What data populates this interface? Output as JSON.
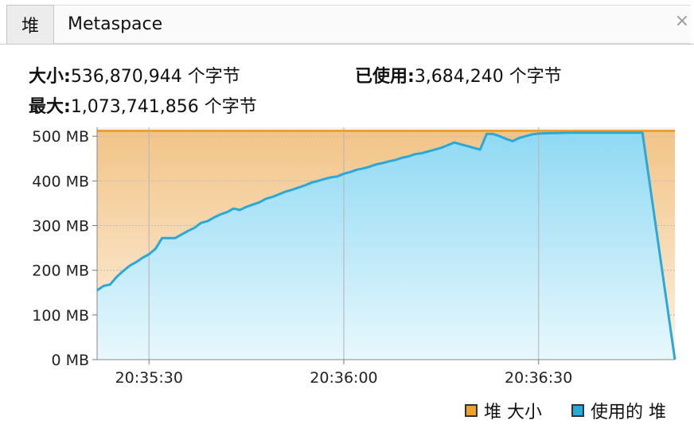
{
  "tabs": {
    "heap": "堆",
    "metaspace": "Metaspace",
    "close": "×"
  },
  "stats": {
    "size_label": "大小:",
    "size_value": "536,870,944 个字节",
    "max_label": "最大:",
    "max_value": "1,073,741,856 个字节",
    "used_label": "已使用:",
    "used_value": "3,684,240 个字节"
  },
  "colors": {
    "heap_size": "#f0a12d",
    "used_heap": "#2aa8d8"
  },
  "chart_data": {
    "type": "area",
    "title": "",
    "xlabel": "",
    "ylabel": "",
    "y_unit": "MB",
    "ylim": [
      0,
      520
    ],
    "yticks": [
      "0 MB",
      "100 MB",
      "200 MB",
      "300 MB",
      "400 MB",
      "500 MB"
    ],
    "ytick_values": [
      0,
      100,
      200,
      300,
      400,
      500
    ],
    "xlim": [
      "20:35:22",
      "20:36:51"
    ],
    "xticks": [
      "20:35:30",
      "20:36:00",
      "20:36:30"
    ],
    "grid": true,
    "legend_position": "bottom-right",
    "series": [
      {
        "name": "堆 大小",
        "color": "#f0a12d",
        "x": [
          "20:35:22",
          "20:36:51"
        ],
        "values": [
          512,
          512
        ]
      },
      {
        "name": "使用的 堆",
        "color": "#2aa8d8",
        "x": [
          "20:35:22",
          "20:35:23",
          "20:35:24",
          "20:35:25",
          "20:35:26",
          "20:35:27",
          "20:35:28",
          "20:35:29",
          "20:35:30",
          "20:35:31",
          "20:35:32",
          "20:35:33",
          "20:35:34",
          "20:35:35",
          "20:35:36",
          "20:35:37",
          "20:35:38",
          "20:35:39",
          "20:35:40",
          "20:35:41",
          "20:35:42",
          "20:35:43",
          "20:35:44",
          "20:35:45",
          "20:35:46",
          "20:35:47",
          "20:35:48",
          "20:35:49",
          "20:35:50",
          "20:35:51",
          "20:35:52",
          "20:35:53",
          "20:35:54",
          "20:35:55",
          "20:35:56",
          "20:35:57",
          "20:35:58",
          "20:35:59",
          "20:36:00",
          "20:36:01",
          "20:36:02",
          "20:36:03",
          "20:36:04",
          "20:36:05",
          "20:36:06",
          "20:36:07",
          "20:36:08",
          "20:36:09",
          "20:36:10",
          "20:36:11",
          "20:36:12",
          "20:36:13",
          "20:36:14",
          "20:36:15",
          "20:36:16",
          "20:36:17",
          "20:36:18",
          "20:36:19",
          "20:36:20",
          "20:36:21",
          "20:36:22",
          "20:36:23",
          "20:36:24",
          "20:36:25",
          "20:36:26",
          "20:36:27",
          "20:36:28",
          "20:36:29",
          "20:36:30",
          "20:36:32",
          "20:36:35",
          "20:36:38",
          "20:36:41",
          "20:36:44",
          "20:36:46",
          "20:36:51"
        ],
        "values": [
          155,
          165,
          168,
          185,
          198,
          210,
          218,
          228,
          236,
          248,
          272,
          272,
          272,
          280,
          288,
          295,
          306,
          310,
          318,
          325,
          330,
          338,
          335,
          342,
          347,
          352,
          360,
          364,
          370,
          376,
          380,
          385,
          390,
          396,
          400,
          404,
          408,
          410,
          416,
          420,
          425,
          428,
          432,
          437,
          440,
          444,
          447,
          452,
          455,
          460,
          462,
          466,
          470,
          474,
          480,
          486,
          482,
          478,
          474,
          470,
          505,
          505,
          500,
          494,
          489,
          496,
          500,
          504,
          506,
          507,
          508,
          508,
          508,
          508,
          508,
          0
        ]
      }
    ]
  }
}
